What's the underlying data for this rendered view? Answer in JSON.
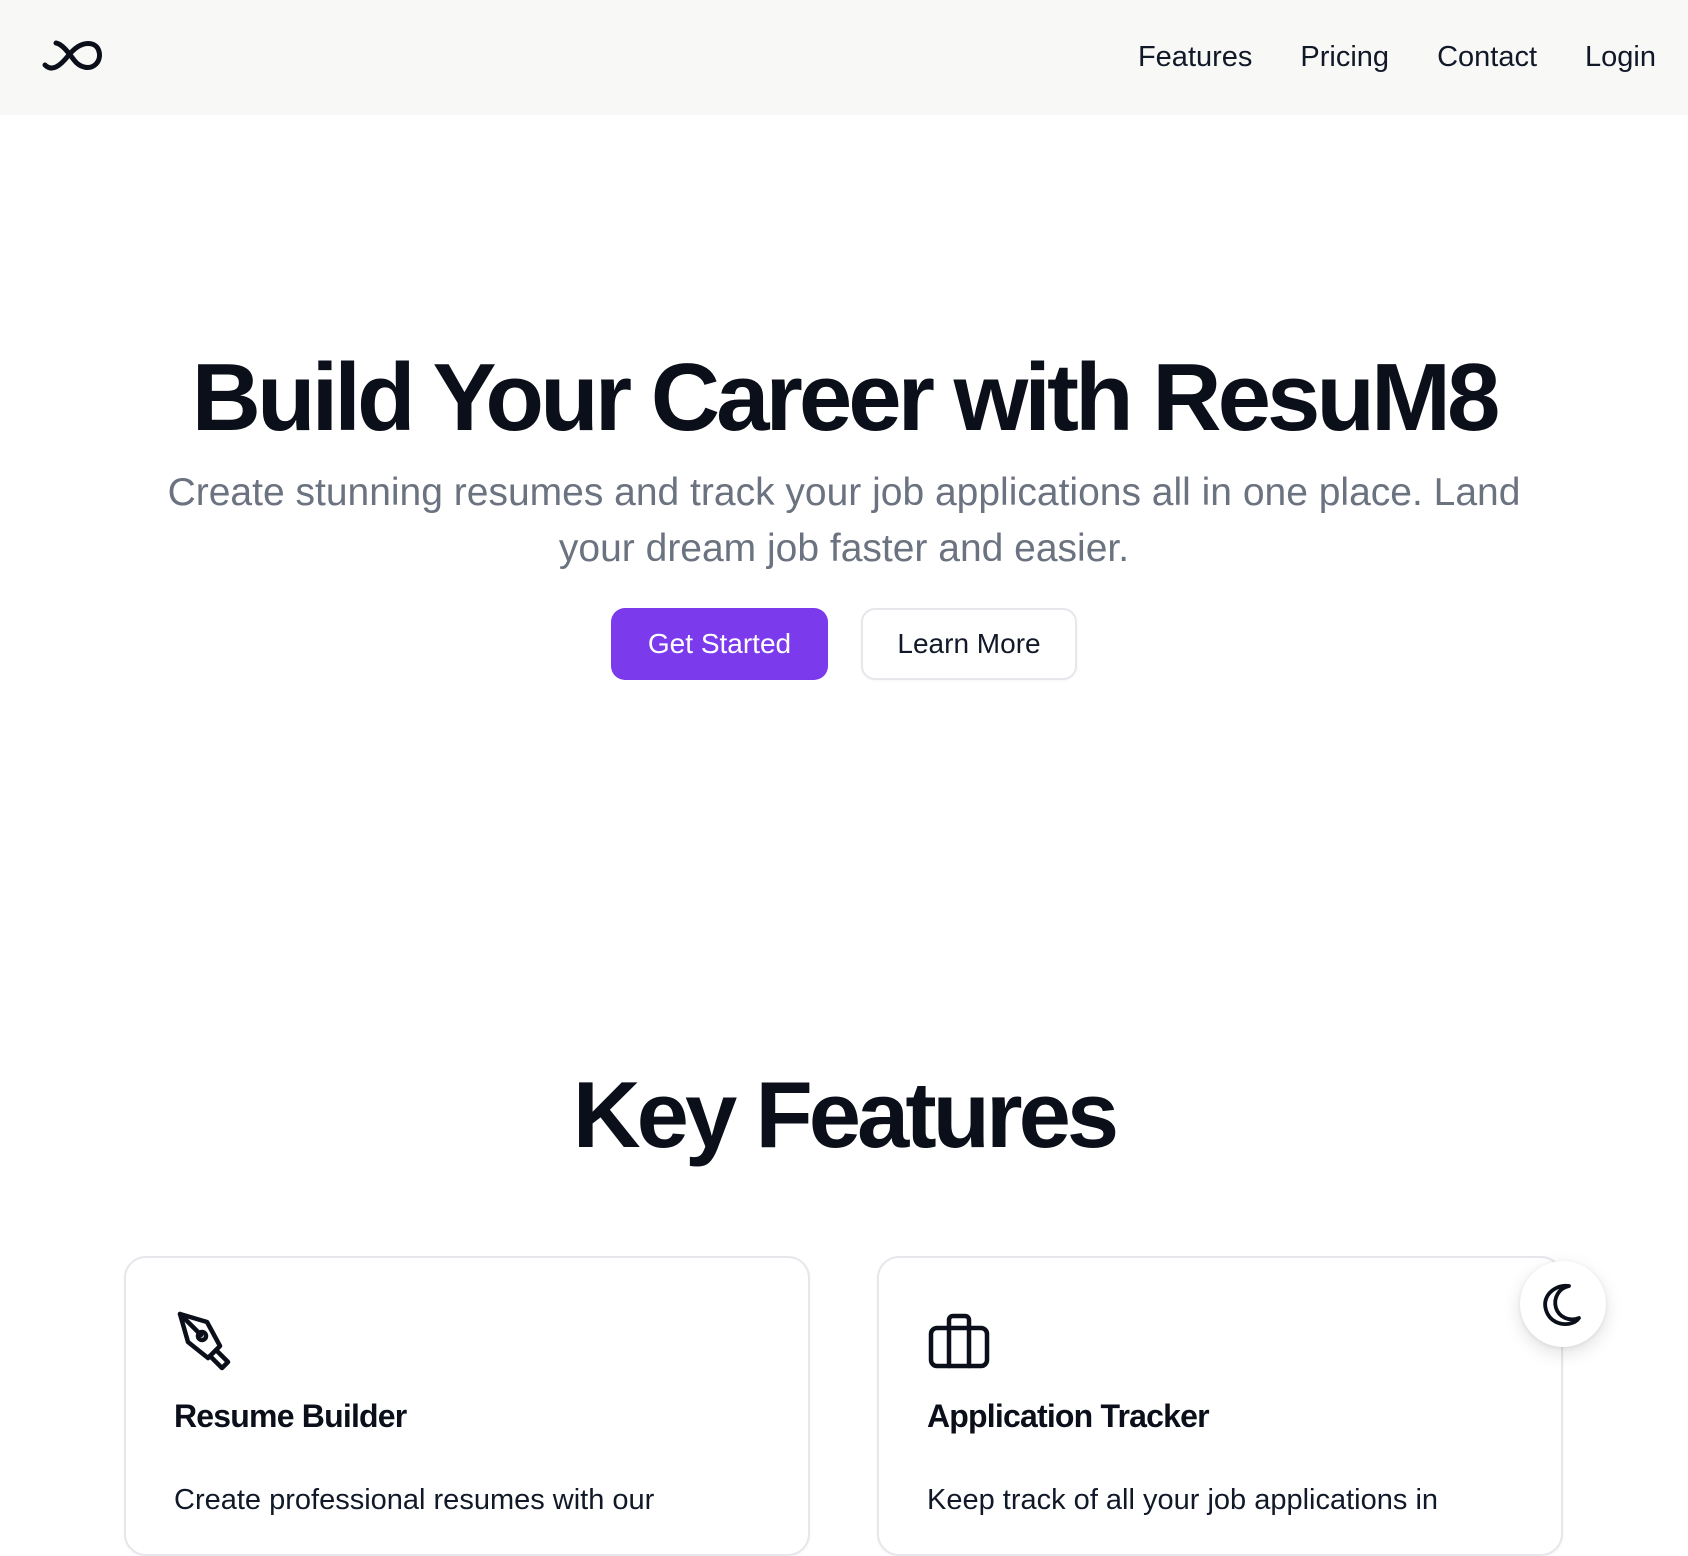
{
  "nav": {
    "logo_icon": "infinity-icon",
    "links": [
      "Features",
      "Pricing",
      "Contact",
      "Login"
    ]
  },
  "hero": {
    "title": "Build Your Career with ResuM8",
    "subtitle": "Create stunning resumes and track your job applications all in one place. Land your dream job faster and easier.",
    "primary_button": "Get Started",
    "secondary_button": "Learn More"
  },
  "features": {
    "title": "Key Features",
    "cards": [
      {
        "icon": "pen-tool-icon",
        "title": "Resume Builder",
        "text": "Create professional resumes with our"
      },
      {
        "icon": "briefcase-icon",
        "title": "Application Tracker",
        "text": "Keep track of all your job applications in"
      }
    ]
  },
  "theme_toggle": {
    "icon": "moon-icon"
  },
  "colors": {
    "accent": "#7c3aed",
    "nav_background": "#f8f8f7",
    "heading": "#0b0f1a",
    "muted_text": "#6b7280"
  }
}
